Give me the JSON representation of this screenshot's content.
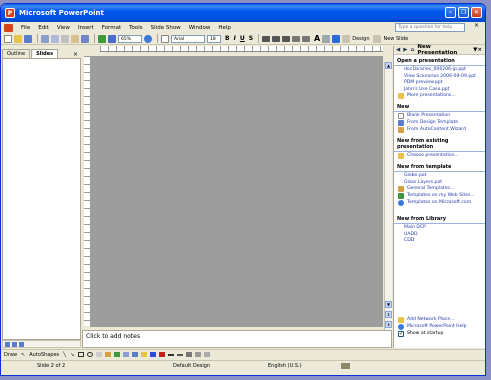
{
  "window": {
    "title": "Microsoft PowerPoint"
  },
  "menu": {
    "items": [
      "File",
      "Edit",
      "View",
      "Insert",
      "Format",
      "Tools",
      "Slide Show",
      "Window",
      "Help"
    ],
    "help_placeholder": "Type a question for help"
  },
  "toolbar": {
    "zoom": "65%",
    "font_name": "Arial",
    "font_size": "18",
    "bold": "B",
    "italic": "I",
    "underline": "U",
    "shadow": "S",
    "grow_font": "A",
    "design_label": "Design",
    "new_slide_label": "New Slide"
  },
  "left_panel": {
    "tab_outline": "Outline",
    "tab_slides": "Slides",
    "close": "×"
  },
  "notes": {
    "placeholder": "Click to add notes"
  },
  "task_pane": {
    "title": "New Presentation",
    "sections": {
      "open": {
        "title": "Open a presentation",
        "files": [
          "doc1braries_006206-jp.ppt",
          "View Scenarios 2006-09-09.ppt",
          "PDM preview.ppt",
          "John's Use Case.ppt"
        ],
        "more": "More presentations..."
      },
      "new": {
        "title": "New",
        "items": [
          "Blank Presentation",
          "From Design Template",
          "From AutoContent Wizard"
        ]
      },
      "existing": {
        "title": "New from existing presentation",
        "items": [
          "Choose presentation..."
        ]
      },
      "template": {
        "title": "New from template",
        "files": [
          "Globe.pot",
          "Glass Layers.pot"
        ],
        "items": [
          "General Templates...",
          "Templates on my Web Sites...",
          "Templates on Microsoft.com"
        ]
      },
      "library": {
        "title": "New from Library",
        "items": [
          "Main DCP",
          "UADD",
          "CDD"
        ]
      }
    },
    "bottom": {
      "add_network": "Add Network Place...",
      "help": "Microsoft PowerPoint Help",
      "show_startup": "Show at startup"
    }
  },
  "drawing": {
    "draw_label": "Draw",
    "autoshapes_label": "AutoShapes"
  },
  "status": {
    "slide": "Slide 2 of 2",
    "design": "Default Design",
    "language": "English (U.S.)"
  },
  "colors": {
    "title_bar": "#0058ee",
    "link": "#1f3aa6",
    "slide_bg": "#9d9d9d"
  }
}
